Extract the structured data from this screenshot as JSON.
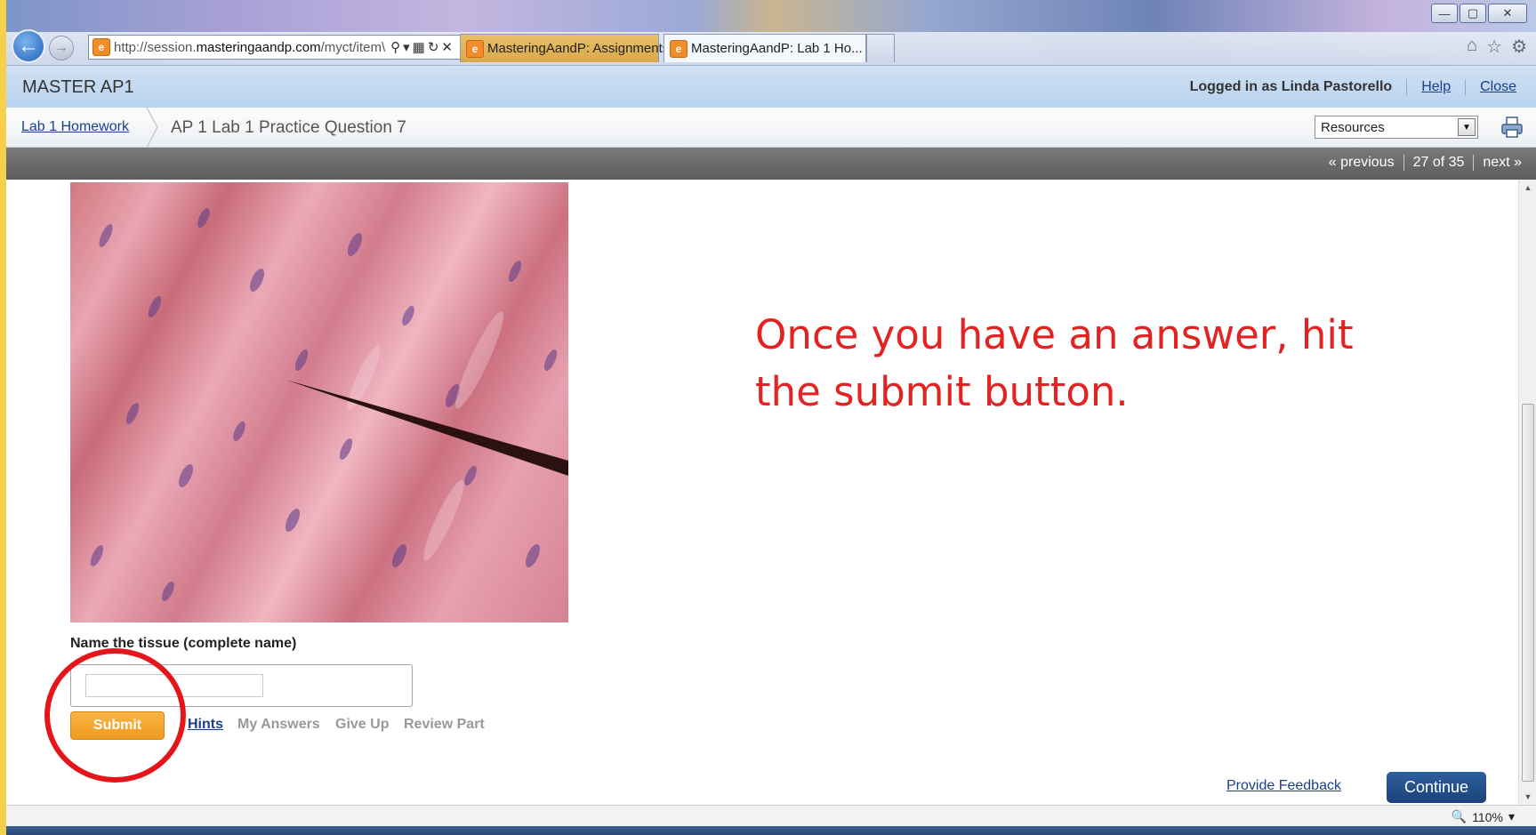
{
  "browser": {
    "address_prefix": "http://session.",
    "address_host": "masteringaandp.com",
    "address_path": "/myct/item\\",
    "tabs": [
      {
        "label": "MasteringAandP: Assignments"
      },
      {
        "label": "MasteringAandP: Lab 1 Ho..."
      }
    ],
    "zoom": "110%"
  },
  "header": {
    "app_title": "MASTER AP1",
    "logged_in": "Logged in as Linda Pastorello",
    "help": "Help",
    "close": "Close"
  },
  "breadcrumb": {
    "parent": "Lab 1 Homework",
    "current": "AP 1 Lab 1 Practice Question 7",
    "resources_selected": "Resources"
  },
  "pager": {
    "previous": "« previous",
    "position": "27 of 35",
    "next": "next »"
  },
  "question": {
    "annotation": "Once you have an answer,  hit the submit button.",
    "prompt": "Name the tissue (complete name)",
    "answer_value": "",
    "submit": "Submit",
    "hints": "Hints",
    "my_answers": "My Answers",
    "give_up": "Give Up",
    "review_part": "Review Part"
  },
  "footer": {
    "feedback": "Provide Feedback",
    "continue": "Continue"
  },
  "colors": {
    "annotation_red": "#e32222",
    "submit_orange": "#f0a02a",
    "continue_blue": "#1f4a85",
    "link_blue": "#1c3f8a"
  }
}
